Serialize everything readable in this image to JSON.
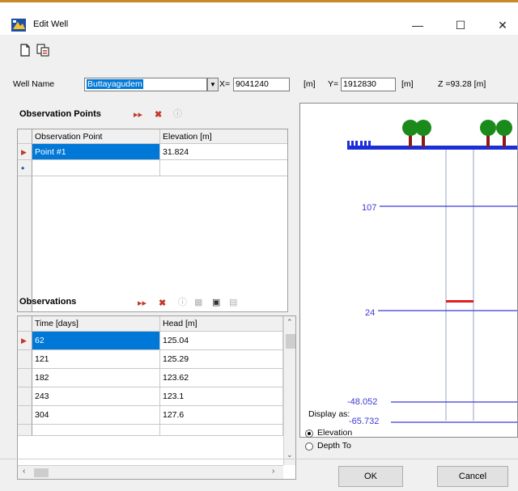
{
  "window": {
    "title": "Edit Well",
    "minimize": "—",
    "maximize": "☐",
    "close": "✕"
  },
  "toolbar": {
    "new_icon": "new-document-icon",
    "copy_icon": "copy-icon"
  },
  "well": {
    "name_label": "Well Name",
    "name_value": "Buttayagudem",
    "x_label": "X=",
    "x_value": "9041240",
    "x_unit": "[m]",
    "y_label": "Y=",
    "y_value": "1912830",
    "y_unit": "[m]",
    "z_text": "Z =93.28 [m]"
  },
  "observation_points": {
    "title": "Observation Points",
    "columns": [
      "Observation Point",
      "Elevation [m]"
    ],
    "rows": [
      {
        "point": "Point #1",
        "elevation": "31.824"
      }
    ]
  },
  "observations": {
    "title": "Observations",
    "columns": [
      "Time [days]",
      "Head [m]"
    ],
    "rows": [
      {
        "time": "62",
        "head": "125.04"
      },
      {
        "time": "121",
        "head": "125.29"
      },
      {
        "time": "182",
        "head": "123.62"
      },
      {
        "time": "243",
        "head": "123.1"
      },
      {
        "time": "304",
        "head": "127.6"
      }
    ]
  },
  "diagram": {
    "levels": [
      "107",
      "24",
      "-48.052",
      "-65.732"
    ]
  },
  "display_as": {
    "label": "Display as:",
    "options": [
      "Elevation",
      "Depth To"
    ],
    "selected": "Elevation"
  },
  "buttons": {
    "ok": "OK",
    "cancel": "Cancel"
  },
  "colors": {
    "selection": "#0078d7",
    "level_line": "#3a3ad8",
    "obs_marker": "#e02020",
    "tree_green": "#1a8a1a"
  }
}
